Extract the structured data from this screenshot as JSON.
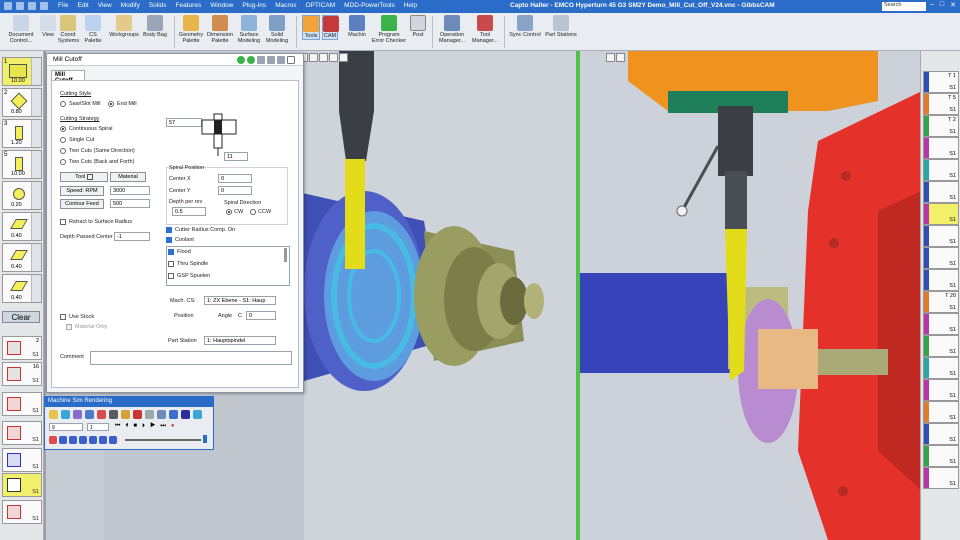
{
  "app": {
    "title": "Capto Halter - EMCO Hyperturn 45 G3 SM2Y Demo_Mill_Cut_Off_V24.vnc - GibbsCAM",
    "menu": [
      "File",
      "Edit",
      "View",
      "Modify",
      "Solids",
      "Features",
      "Window",
      "Plug-Ins",
      "Macros",
      "OPTICAM",
      "MDD-PowerTools",
      "Help"
    ],
    "search_placeholder": "Search"
  },
  "ribbon": {
    "buttons": [
      {
        "label": "Document\nControl..."
      },
      {
        "label": "View"
      },
      {
        "label": "Coord\nSystems"
      },
      {
        "label": "CS Palette"
      },
      {
        "label": "Workgroups"
      },
      {
        "label": "Body Bag"
      },
      {
        "label": "Geometry\nPalette"
      },
      {
        "label": "Dimension\nPalette"
      },
      {
        "label": "Surface\nModeling"
      },
      {
        "label": "Solid\nModeling"
      },
      {
        "label": "Tools"
      },
      {
        "label": "CAM"
      },
      {
        "label": "Machin"
      },
      {
        "label": "Program\nError Checker"
      },
      {
        "label": "Post"
      },
      {
        "label": "Operation\nManager..."
      },
      {
        "label": "Tool\nManager..."
      },
      {
        "label": "Sync Control"
      },
      {
        "label": "Part Stations"
      }
    ]
  },
  "left_tools": [
    {
      "num": "1",
      "val": "10.00"
    },
    {
      "num": "2",
      "val": "0.80"
    },
    {
      "num": "3",
      "val": "1.20"
    },
    {
      "num": "5",
      "val": "10.00"
    },
    {
      "num": "",
      "val": "0.20"
    },
    {
      "num": "",
      "val": "0.40"
    },
    {
      "num": "",
      "val": "0.40"
    },
    {
      "num": "",
      "val": "0.40"
    }
  ],
  "clear_label": "Clear",
  "left_ops": [
    {
      "n": "2",
      "s": "S1"
    },
    {
      "n": "16",
      "s": "S1"
    },
    {
      "n": "",
      "s": "S1"
    },
    {
      "n": "",
      "s": "S1"
    },
    {
      "n": "",
      "s": "S1"
    },
    {
      "n": "",
      "s": "S1"
    },
    {
      "n": "",
      "s": "S1"
    }
  ],
  "right_ops": [
    {
      "n": "T 1",
      "s": "S1"
    },
    {
      "n": "T 5",
      "s": "S1"
    },
    {
      "n": "T 2",
      "s": "S1"
    },
    {
      "n": "",
      "s": "S1"
    },
    {
      "n": "",
      "s": "S1"
    },
    {
      "n": "",
      "s": "S1"
    },
    {
      "n": "",
      "s": "S1"
    },
    {
      "n": "",
      "s": "S1"
    },
    {
      "n": "",
      "s": "S1"
    },
    {
      "n": "",
      "s": "S1"
    },
    {
      "n": "T 20",
      "s": "S1"
    },
    {
      "n": "",
      "s": "S1"
    },
    {
      "n": "",
      "s": "S1"
    },
    {
      "n": "",
      "s": "S1"
    },
    {
      "n": "",
      "s": "S1"
    },
    {
      "n": "",
      "s": "S1"
    },
    {
      "n": "",
      "s": "S1"
    },
    {
      "n": "",
      "s": "S1"
    },
    {
      "n": "",
      "s": "S1"
    }
  ],
  "dialog": {
    "title": "Mill Cutoff",
    "tab": "Mill Cutoff",
    "cutting_style": {
      "label": "Cutting Style",
      "options": [
        "Saw/Slot Mill",
        "End Mill"
      ],
      "selected": 1
    },
    "cutting_strategy": {
      "label": "Cutting Strategy",
      "options": [
        "Continuous Spiral",
        "Single Cut",
        "Two Cuts (Same Direction)",
        "Two Cuts (Back and Forth)"
      ],
      "selected": 0
    },
    "preview_top_value": "57",
    "preview_bottom_value": "11",
    "tool_button": "Tool",
    "material_button": "Material",
    "speed_label": "Speed: RPM",
    "speed_value": "3000",
    "contour_label": "Contour Feed",
    "contour_value": "500",
    "spiral": {
      "title": "Spiral Position",
      "center_x_label": "Center X",
      "center_x_value": "0",
      "center_y_label": "Center Y",
      "center_y_value": "0",
      "depth_label": "Depth per rev",
      "depth_value": "0.5",
      "direction_label": "Spiral Direction",
      "cw": "CW",
      "ccw": "CCW"
    },
    "retract_label": "Retract to Surface Radius",
    "depth_passed_label": "Depth Passed Center",
    "depth_passed_value": "-1",
    "cutter_comp_label": "Cutter Radius Comp. On",
    "coolant_label": "Coolant",
    "coolant_items": [
      "Flood",
      "Thru Spindle",
      "GSP Spuelen"
    ],
    "use_stock_label": "Use Stock",
    "material_only_label": "Material Only",
    "mach_cs_label": "Mach. CS:",
    "mach_cs_value": "1: ZX Ebene - S1: Haup",
    "position_label": "Position",
    "angle_label": "Angle",
    "c_label": "C",
    "c_value": "0",
    "part_station_label": "Part Station",
    "part_station_value": "1: Hauptspindel",
    "comment_label": "Comment"
  },
  "sim": {
    "title": "Machine Sim Rendering",
    "field1": "9",
    "field2": "1"
  },
  "colors": {
    "titlebar": "#2a6cc7",
    "chuck_red": "#e4322b",
    "workpiece_blue": "#4b57c8",
    "tool_yellow": "#e6e01f",
    "active_green": "#4fc24a"
  }
}
